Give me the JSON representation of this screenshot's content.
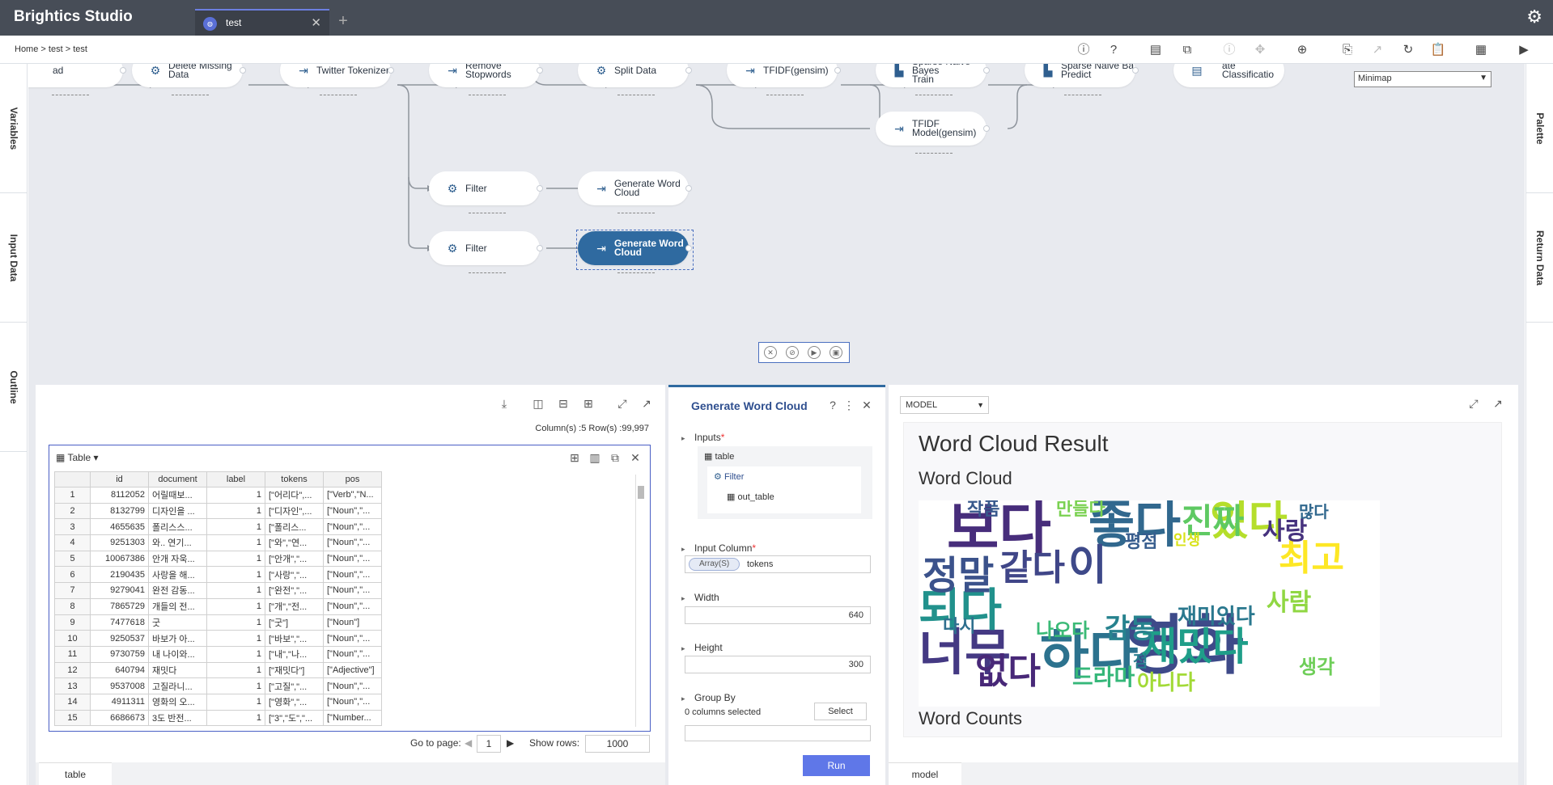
{
  "app": {
    "title": "Brightics Studio",
    "tab_label": "test",
    "tab_icon": "app-icon"
  },
  "breadcrumb": {
    "home": "Home",
    "sep": ">",
    "project": "test",
    "page": "test"
  },
  "side_left": [
    "Variables",
    "Input Data",
    "Outline"
  ],
  "side_right": [
    "Palette",
    "Return Data"
  ],
  "minimap": {
    "label": "Minimap"
  },
  "nodes": {
    "n0": "ad",
    "n1": "Delete Missing Data",
    "n2": "Twitter Tokenizer",
    "n3": "Remove Stopwords",
    "n4": "Split Data",
    "n5": "TFIDF(gensim)",
    "n6a": "Sparse Naive Bayes",
    "n6b": "Train",
    "n7a": "Sparse Naive Ba",
    "n7b": "Predict",
    "n8a": "ate",
    "n8b": "Classificatio",
    "n9a": "TFIDF",
    "n9b": "Model(gensim)",
    "n10": "Filter",
    "n11a": "Generate Word",
    "n11b": "Cloud",
    "n12": "Filter",
    "n13a": "Generate Word",
    "n13b": "Cloud"
  },
  "table_panel": {
    "info": "Column(s) :5   Row(s) :99,997",
    "title": "Table",
    "headers": [
      "",
      "id",
      "document",
      "label",
      "tokens",
      "pos"
    ],
    "rows": [
      [
        "1",
        "8112052",
        "어릴때보...",
        "1",
        "[\"어리다\",...",
        "[\"Verb\",\"N..."
      ],
      [
        "2",
        "8132799",
        "디자인을 ...",
        "1",
        "[\"디자인\",...",
        "[\"Noun\",\"..."
      ],
      [
        "3",
        "4655635",
        "폴리스스...",
        "1",
        "[\"폴리스...",
        "[\"Noun\",\"..."
      ],
      [
        "4",
        "9251303",
        "와.. 연기...",
        "1",
        "[\"와\",\"연...",
        "[\"Noun\",\"..."
      ],
      [
        "5",
        "10067386",
        "안개 자욱...",
        "1",
        "[\"안개\",\"...",
        "[\"Noun\",\"..."
      ],
      [
        "6",
        "2190435",
        "사랑을 해...",
        "1",
        "[\"사랑\",\"...",
        "[\"Noun\",\"..."
      ],
      [
        "7",
        "9279041",
        "완전 감동...",
        "1",
        "[\"완전\",\"...",
        "[\"Noun\",\"..."
      ],
      [
        "8",
        "7865729",
        "개들의 전...",
        "1",
        "[\"개\",\"전...",
        "[\"Noun\",\"..."
      ],
      [
        "9",
        "7477618",
        "굿",
        "1",
        "[\"굿\"]",
        "[\"Noun\"]"
      ],
      [
        "10",
        "9250537",
        "바보가 아...",
        "1",
        "[\"바보\",\"...",
        "[\"Noun\",\"..."
      ],
      [
        "11",
        "9730759",
        "내 나이와...",
        "1",
        "[\"내\",\"나...",
        "[\"Noun\",\"..."
      ],
      [
        "12",
        "640794",
        "재밋다",
        "1",
        "[\"재밋다\"]",
        "[\"Adjective\"]"
      ],
      [
        "13",
        "9537008",
        "고질라니...",
        "1",
        "[\"고질\",\"...",
        "[\"Noun\",\"..."
      ],
      [
        "14",
        "4911311",
        "영화의 오...",
        "1",
        "[\"영화\",\"...",
        "[\"Noun\",\"..."
      ],
      [
        "15",
        "6686673",
        "3도 반전...",
        "1",
        "[\"3\",\"도\",\"...",
        "[\"Number..."
      ]
    ],
    "goto_label": "Go to page:",
    "goto_value": "1",
    "showrows_label": "Show rows:",
    "showrows_value": "1000",
    "bottom_tab": "table"
  },
  "function_panel": {
    "title": "Generate Word Cloud",
    "inputs_label": "Inputs",
    "input_table": "table",
    "input_source": "Filter",
    "input_out": "out_table",
    "input_column_label": "Input Column",
    "input_column_tag": "Array(S)",
    "input_column_value": "tokens",
    "width_label": "Width",
    "width_value": "640",
    "height_label": "Height",
    "height_value": "300",
    "groupby_label": "Group By",
    "groupby_selected": "0 columns selected",
    "select_label": "Select",
    "run_label": "Run"
  },
  "result_panel": {
    "model_select": "MODEL",
    "title": "Word Cloud Result",
    "subtitle": "Word Cloud",
    "subtitle2": "Word Counts",
    "bottom_tab": "model",
    "cloud_words": [
      {
        "t": "영화",
        "c": "#3e4a89"
      },
      {
        "t": "하다",
        "c": "#2c728e"
      },
      {
        "t": "보다",
        "c": "#472d7b"
      },
      {
        "t": "좋다",
        "c": "#31688e"
      },
      {
        "t": "있다",
        "c": "#b5de2b"
      },
      {
        "t": "너무",
        "c": "#443983"
      },
      {
        "t": "되다",
        "c": "#21918c"
      },
      {
        "t": "정말",
        "c": "#3b528b"
      },
      {
        "t": "재밌다",
        "c": "#1f9e89"
      },
      {
        "t": "이",
        "c": "#3e4989"
      },
      {
        "t": "진짜",
        "c": "#5ec962"
      },
      {
        "t": "같다",
        "c": "#404688"
      },
      {
        "t": "감동",
        "c": "#26828e"
      },
      {
        "t": "없다",
        "c": "#482878"
      },
      {
        "t": "드라마",
        "c": "#35b779"
      },
      {
        "t": "생각",
        "c": "#6ece58"
      },
      {
        "t": "만들다",
        "c": "#7ad151"
      },
      {
        "t": "평점",
        "c": "#365c8d"
      },
      {
        "t": "재미있다",
        "c": "#2a788e"
      },
      {
        "t": "최고",
        "c": "#fde725"
      },
      {
        "t": "나오다",
        "c": "#3aba76"
      },
      {
        "t": "사람",
        "c": "#90d743"
      },
      {
        "t": "아니다",
        "c": "#a2da37"
      },
      {
        "t": "사랑",
        "c": "#46327e"
      },
      {
        "t": "많다",
        "c": "#31688e"
      },
      {
        "t": "작품",
        "c": "#38598c"
      },
      {
        "t": "다시",
        "c": "#2e6f8e"
      },
      {
        "t": "점",
        "c": "#287d8e"
      },
      {
        "t": "인생",
        "c": "#d8e219"
      }
    ]
  }
}
